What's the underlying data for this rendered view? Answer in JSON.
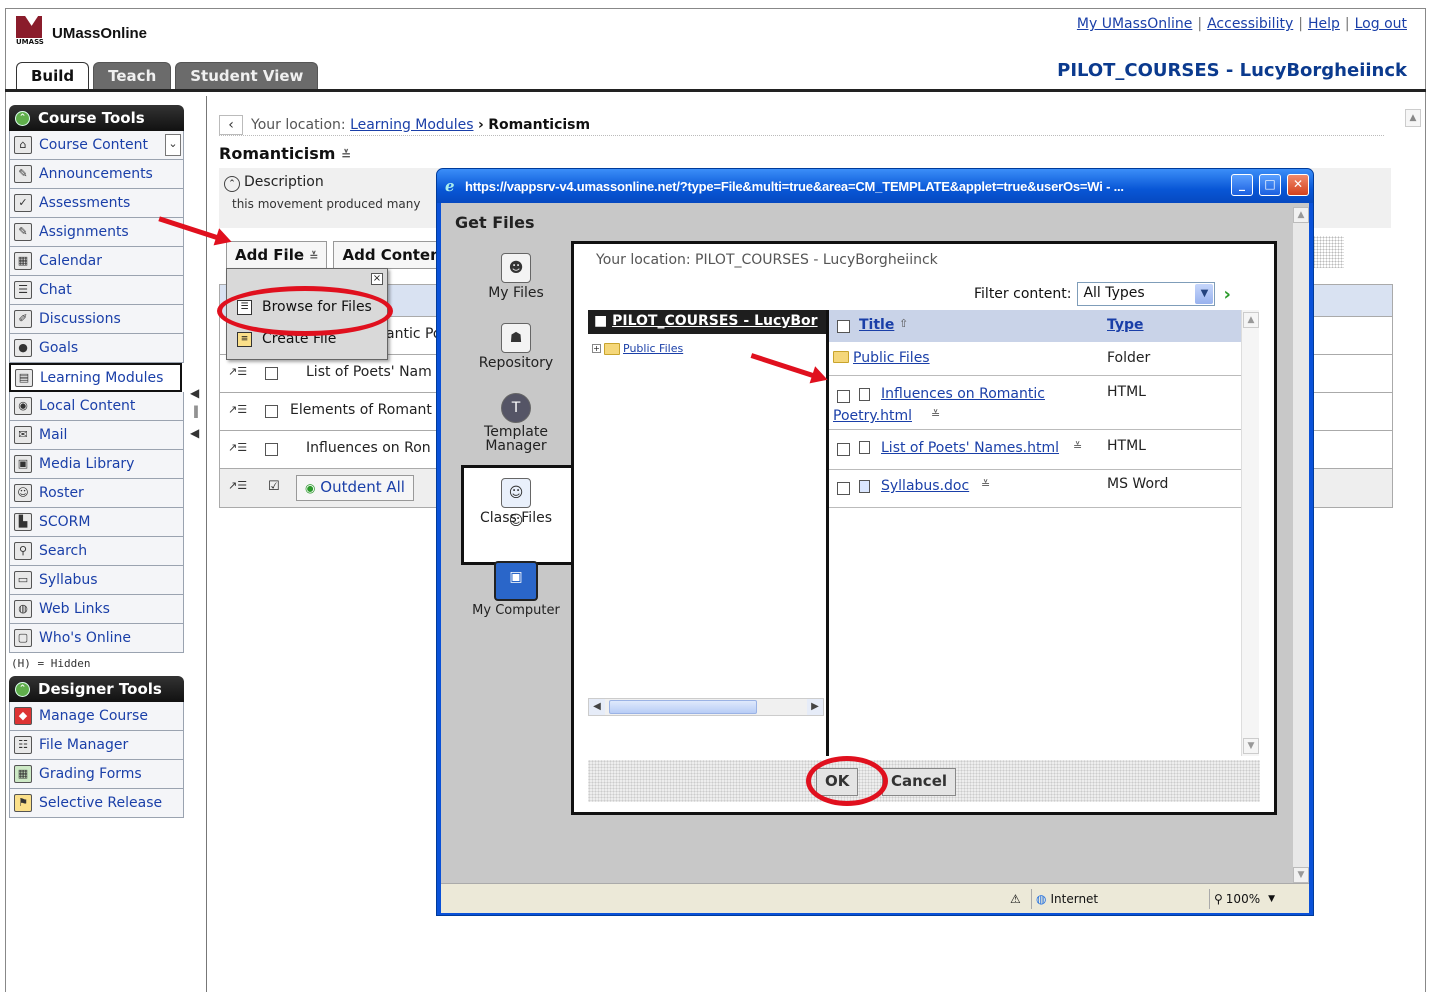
{
  "app": {
    "brand": "UMassOnline",
    "logo_sub": "UMASS"
  },
  "top_links": [
    "My UMassOnline",
    "Accessibility",
    "Help",
    "Log out"
  ],
  "course_name": "PILOT_COURSES - LucyBorgheiinck",
  "tabs": [
    "Build",
    "Teach",
    "Student View"
  ],
  "course_tools": {
    "title": "Course Tools",
    "items": [
      "Course Content",
      "Announcements",
      "Assessments",
      "Assignments",
      "Calendar",
      "Chat",
      "Discussions",
      "Goals",
      "Learning Modules",
      "Local Content",
      "Mail",
      "Media Library",
      "Roster",
      "SCORM",
      "Search",
      "Syllabus",
      "Web Links",
      "Who's Online"
    ],
    "hidden_note": "(H) = Hidden"
  },
  "designer_tools": {
    "title": "Designer Tools",
    "items": [
      "Manage Course",
      "File Manager",
      "Grading Forms",
      "Selective Release"
    ]
  },
  "main": {
    "location_prefix": "Your location:",
    "location_link": "Learning Modules",
    "location_sep": "›",
    "location_current": "Romanticism",
    "title": "Romanticism",
    "description_label": "Description",
    "description_text": "this movement produced many",
    "toolbar": {
      "add_file": "Add File",
      "add_content": "Add Conten"
    },
    "add_file_menu": [
      "Browse for Files",
      "Create File"
    ],
    "rows": [
      "antic Po",
      "List of Poets' Nam",
      "Elements of Romant",
      "Influences on Ron"
    ],
    "outdent_all": "Outdent All"
  },
  "popup": {
    "window_title": "https://vappsrv-v4.umassonline.net/?type=File&multi=true&area=CM_TEMPLATE&applet=true&userOs=Wi - ...",
    "heading": "Get Files",
    "sources": [
      "My Files",
      "Repository",
      "Template Manager",
      "Class Files",
      "My Computer"
    ],
    "location": "Your location: PILOT_COURSES - LucyBorgheiinck",
    "filter_label": "Filter content:",
    "filter_value": "All Types",
    "tree_root": "PILOT_COURSES - LucyBor",
    "tree_child": "Public Files",
    "columns": {
      "title": "Title",
      "type": "Type"
    },
    "files": [
      {
        "name": "Public Files",
        "type": "Folder"
      },
      {
        "name_line1": "Influences on Romantic",
        "name_line2": "Poetry.html",
        "type": "HTML"
      },
      {
        "name": "List of Poets' Names.html",
        "type": "HTML"
      },
      {
        "name": "Syllabus.doc",
        "type": "MS Word"
      }
    ],
    "ok": "OK",
    "cancel": "Cancel",
    "status_zone": "Internet",
    "status_zoom": "100%"
  },
  "colors": {
    "annotation": "#e0101e",
    "xp_blue": "#0a51d8",
    "link": "#1a3fa8"
  }
}
